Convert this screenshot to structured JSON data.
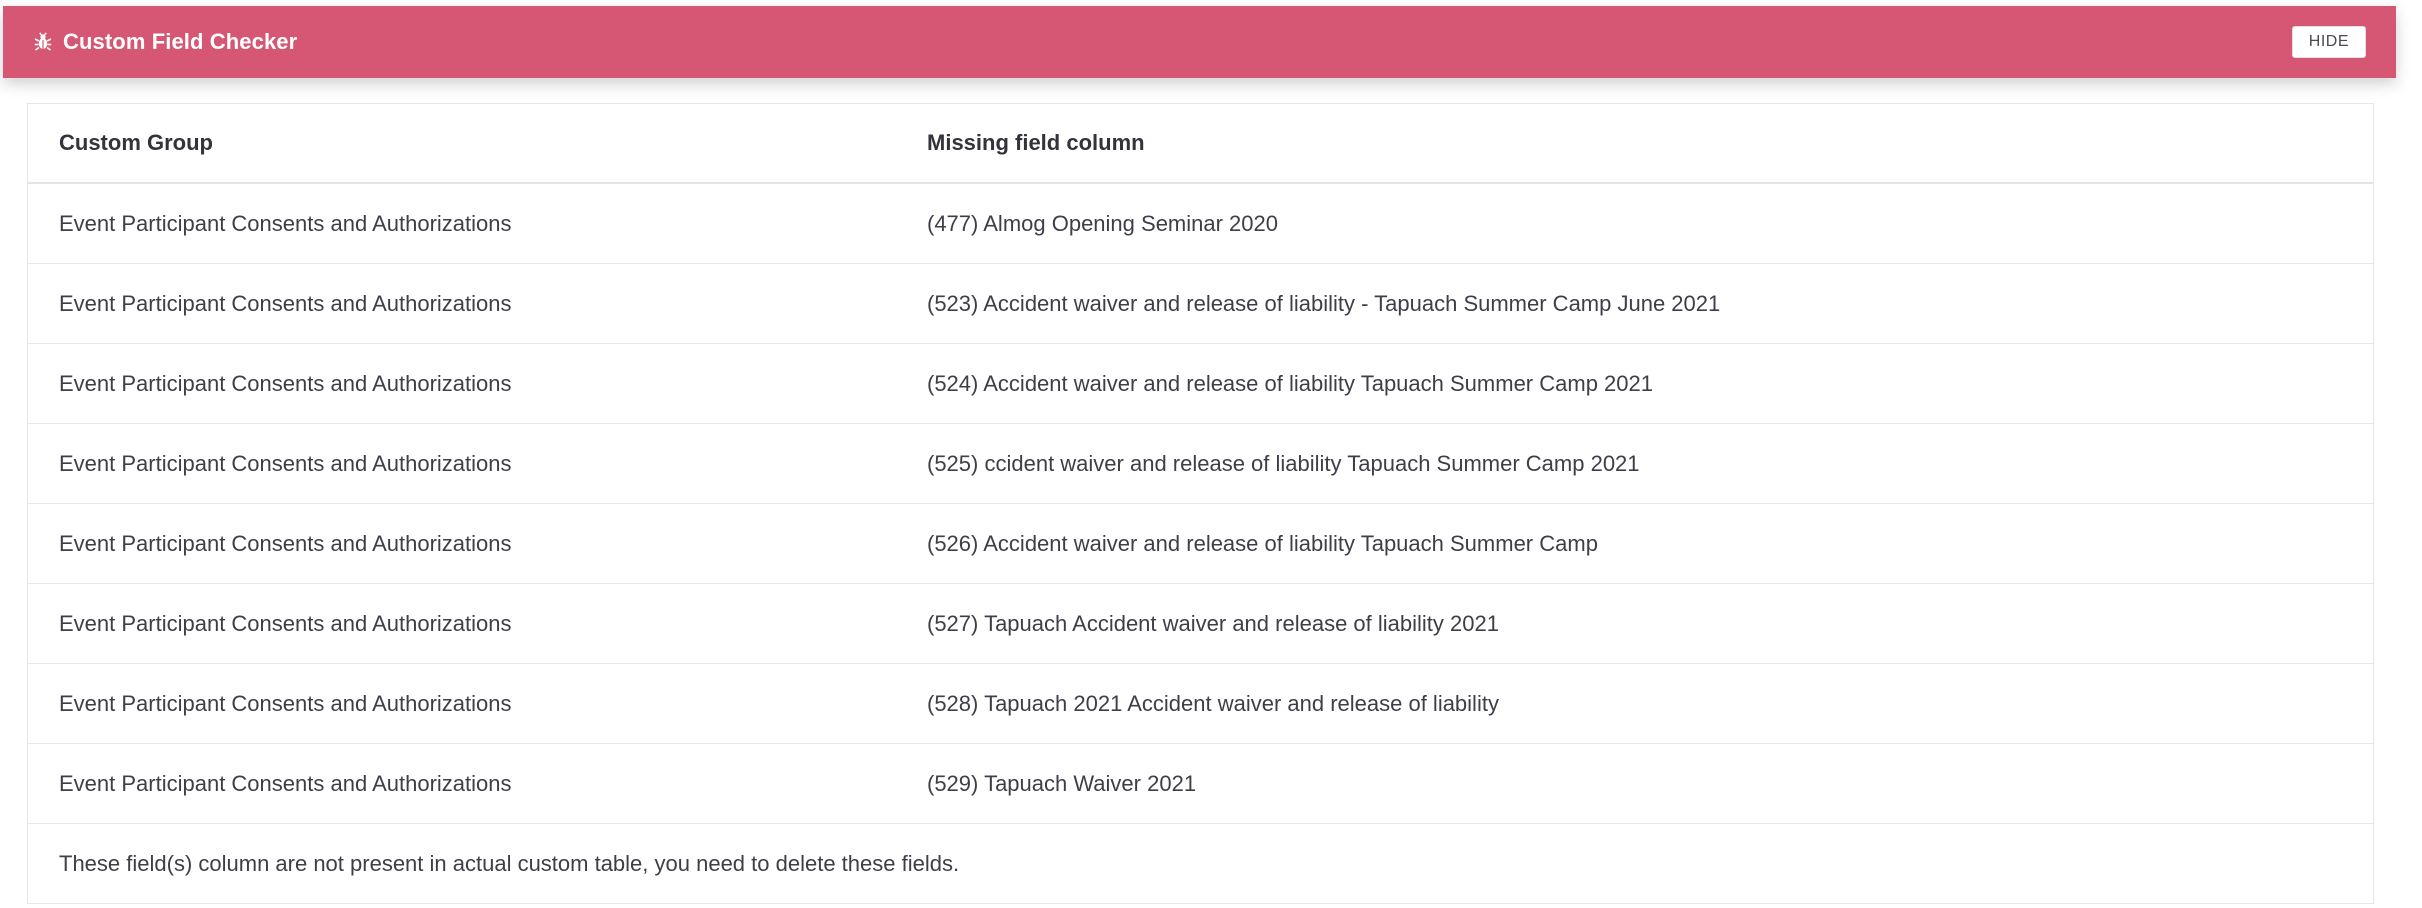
{
  "header": {
    "title": "Custom Field Checker",
    "icon": "bug-icon",
    "hide_label": "HIDE",
    "background_color": "#d65773"
  },
  "table": {
    "columns": [
      "Custom Group",
      "Missing field column"
    ],
    "rows": [
      {
        "group": "Event Participant Consents and Authorizations",
        "field": "(477) Almog Opening Seminar 2020"
      },
      {
        "group": "Event Participant Consents and Authorizations",
        "field": "(523) Accident waiver and release of liability - Tapuach Summer Camp June 2021"
      },
      {
        "group": "Event Participant Consents and Authorizations",
        "field": "(524) Accident waiver and release of liability Tapuach Summer Camp 2021"
      },
      {
        "group": "Event Participant Consents and Authorizations",
        "field": "(525) ccident waiver and release of liability Tapuach Summer Camp 2021"
      },
      {
        "group": "Event Participant Consents and Authorizations",
        "field": "(526) Accident waiver and release of liability Tapuach Summer Camp"
      },
      {
        "group": "Event Participant Consents and Authorizations",
        "field": "(527) Tapuach Accident waiver and release of liability 2021"
      },
      {
        "group": "Event Participant Consents and Authorizations",
        "field": "(528) Tapuach 2021 Accident waiver and release of liability"
      },
      {
        "group": "Event Participant Consents and Authorizations",
        "field": "(529) Tapuach Waiver 2021"
      }
    ],
    "footer_note": "These field(s) column are not present in actual custom table, you need to delete these fields."
  }
}
